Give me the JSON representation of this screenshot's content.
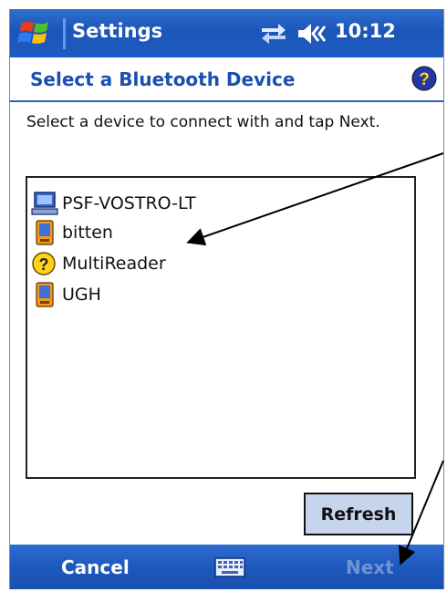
{
  "titlebar": {
    "title": "Settings",
    "time": "10:12",
    "icons": [
      "windows-start-icon",
      "sync-icon",
      "speaker-icon"
    ]
  },
  "header": {
    "title": "Select a Bluetooth Device",
    "help_icon": "help-icon"
  },
  "instruction": "Select a device to connect with and tap Next.",
  "devices": [
    {
      "label": "PSF-VOSTRO-LT",
      "icon": "computer-icon"
    },
    {
      "label": "bitten",
      "icon": "pda-icon"
    },
    {
      "label": "MultiReader",
      "icon": "unknown-device-icon"
    },
    {
      "label": "UGH",
      "icon": "pda-icon"
    }
  ],
  "refresh_label": "Refresh",
  "softkeys": {
    "left": "Cancel",
    "right": "Next",
    "center_icon": "keyboard-icon"
  },
  "colors": {
    "titlebar": "#1b55b8",
    "header_text": "#1a4fb0",
    "next_disabled": "#6f94cf",
    "refresh_bg": "#c7d5ec"
  }
}
